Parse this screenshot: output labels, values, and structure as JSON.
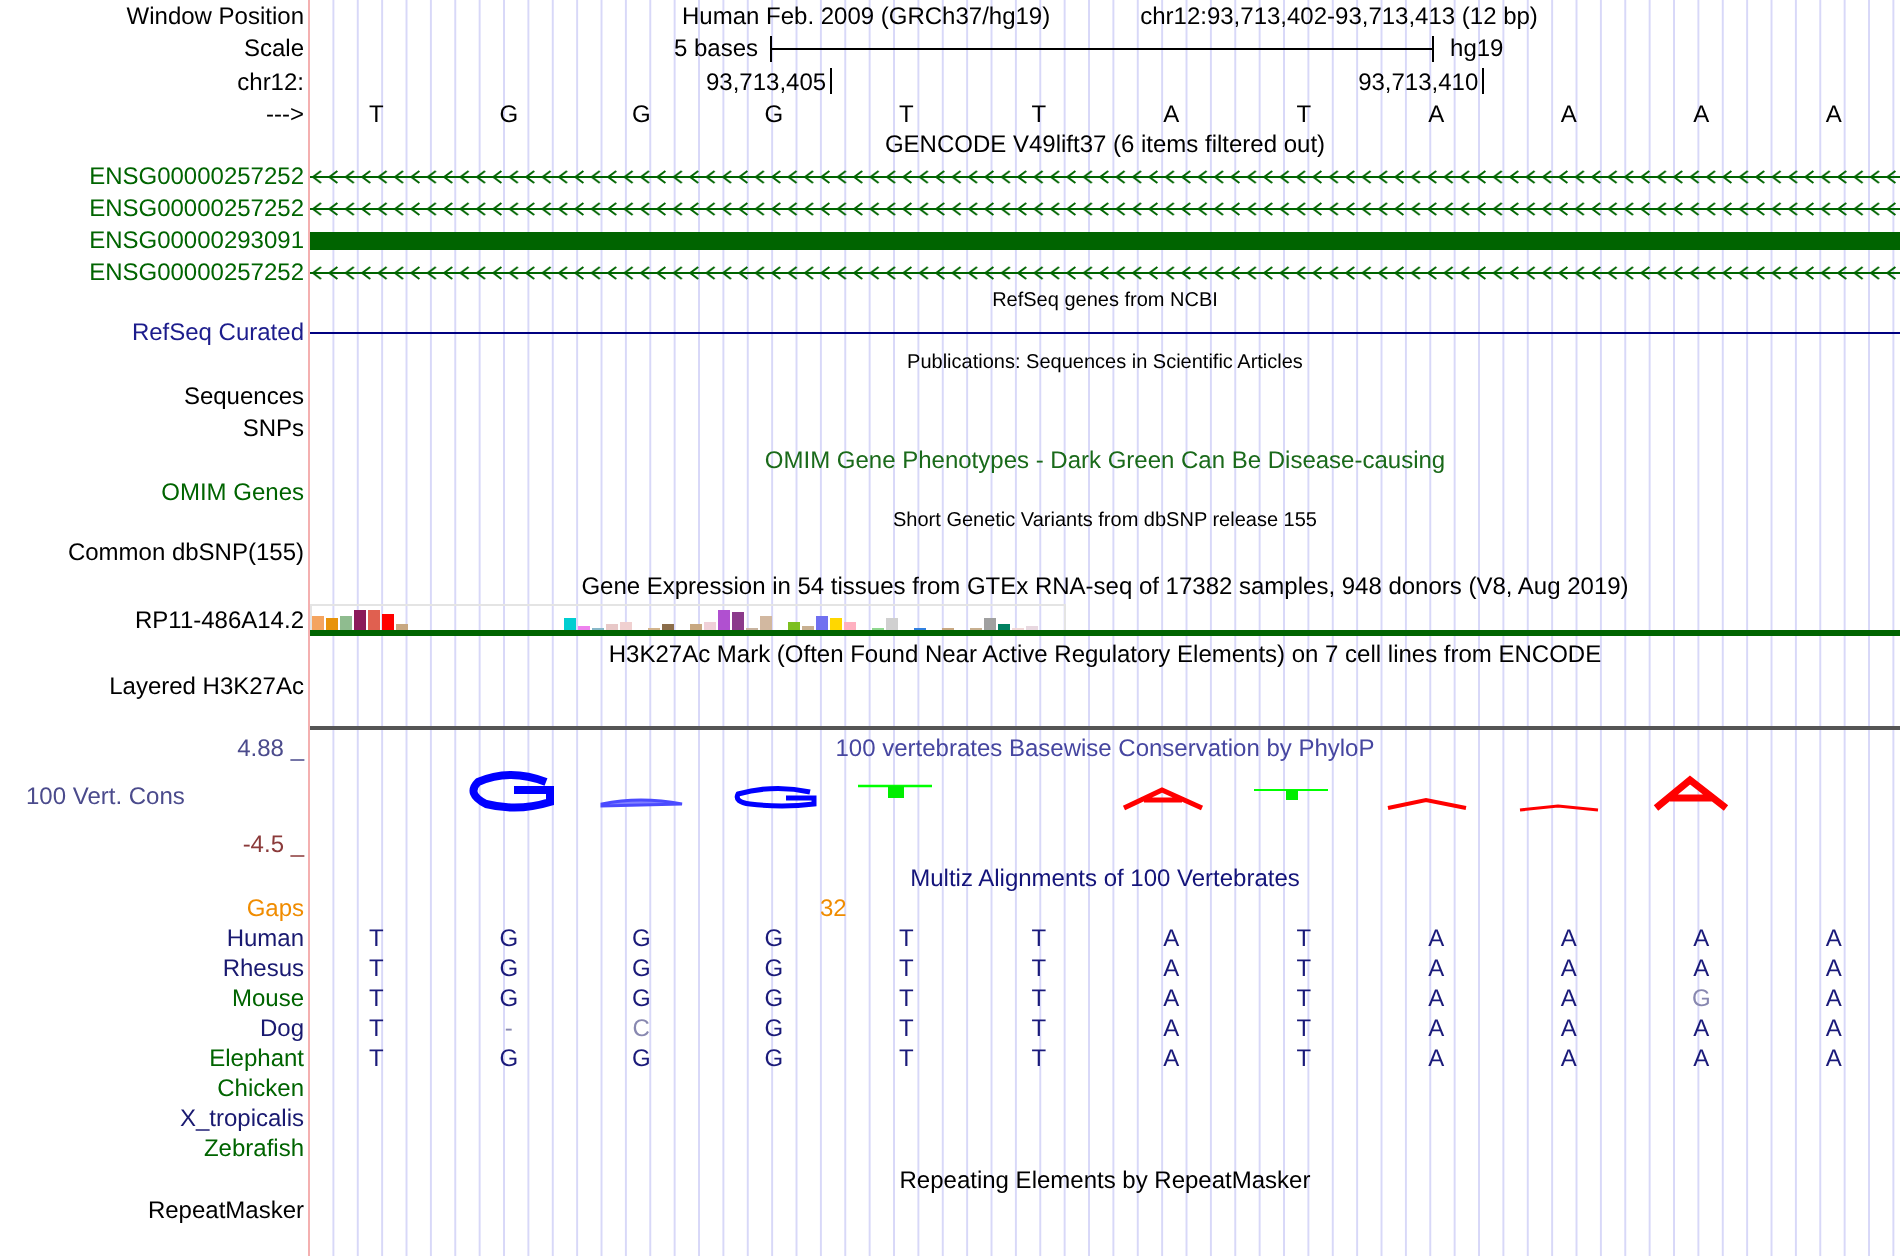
{
  "header": {
    "labels": [
      "Window Position",
      "Scale",
      "chr12:",
      "--->"
    ],
    "assembly_title": "Human Feb. 2009 (GRCh37/hg19)",
    "position": "chr12:93,713,402-93,713,413 (12 bp)",
    "scale_text": "5 bases",
    "assembly": "hg19",
    "ticks": [
      "93,713,405",
      "93,713,410"
    ]
  },
  "bases": [
    "T",
    "G",
    "G",
    "G",
    "T",
    "T",
    "A",
    "T",
    "A",
    "A",
    "A",
    "A"
  ],
  "tracks": [
    {
      "kind": "genes",
      "title": "GENCODE V49lift37 (6 items filtered out)",
      "items": [
        {
          "label": "ENSG00000257252",
          "kind": "arrows",
          "color": "#006400"
        },
        {
          "label": "ENSG00000257252",
          "kind": "arrows",
          "color": "#006400"
        },
        {
          "label": "ENSG00000293091",
          "kind": "block",
          "color": "#006400"
        },
        {
          "label": "ENSG00000257252",
          "kind": "arrows",
          "color": "#006400"
        }
      ]
    },
    {
      "kind": "refseq",
      "title": "RefSeq genes from NCBI",
      "label": "RefSeq Curated",
      "color": "#1c1c8c"
    },
    {
      "kind": "pubs",
      "title": "Publications: Sequences in Scientific Articles",
      "labels": [
        "Sequences",
        "SNPs"
      ],
      "color": "#000000"
    },
    {
      "kind": "omim",
      "title": "OMIM Gene Phenotypes - Dark Green Can Be Disease-causing",
      "label": "OMIM Genes",
      "color": "#006400"
    },
    {
      "kind": "snp",
      "title": "Short Genetic Variants from dbSNP release 155",
      "label": "Common dbSNP(155)",
      "color": "#000000"
    },
    {
      "kind": "gtex",
      "title": "Gene Expression in 54 tissues from GTEx RNA-seq of 17382 samples, 948 donors (V8, Aug 2019)",
      "label": "RP11-486A14.2",
      "color": "#000000"
    },
    {
      "kind": "chip",
      "title": "H3K27Ac Mark (Often Found Near Active Regulatory Elements) on 7 cell lines from ENCODE",
      "label": "Layered H3K27Ac",
      "color": "#000000"
    },
    {
      "kind": "phylop",
      "title": "100 vertebrates Basewise Conservation by PhyloP",
      "label": "100 Vert. Cons",
      "max": "4.88 _",
      "min": "-4.5 _",
      "color": "#4b4b8c"
    },
    {
      "kind": "multiz",
      "title": "Multiz Alignments of 100 Vertebrates",
      "gaps": {
        "label": "Gaps",
        "value": "32"
      },
      "species": [
        {
          "name": "Human",
          "color": "#191970",
          "bases": [
            {
              "b": "T",
              "match": true
            },
            {
              "b": "G",
              "match": true
            },
            {
              "b": "G",
              "match": true
            },
            {
              "b": "G",
              "match": true
            },
            {
              "b": "T",
              "match": true
            },
            {
              "b": "T",
              "match": true
            },
            {
              "b": "A",
              "match": true
            },
            {
              "b": "T",
              "match": true
            },
            {
              "b": "A",
              "match": true
            },
            {
              "b": "A",
              "match": true
            },
            {
              "b": "A",
              "match": true
            },
            {
              "b": "A",
              "match": true
            }
          ]
        },
        {
          "name": "Rhesus",
          "color": "#191970",
          "bases": [
            {
              "b": "T",
              "match": true
            },
            {
              "b": "G",
              "match": true
            },
            {
              "b": "G",
              "match": true
            },
            {
              "b": "G",
              "match": true
            },
            {
              "b": "T",
              "match": true
            },
            {
              "b": "T",
              "match": true
            },
            {
              "b": "A",
              "match": true
            },
            {
              "b": "T",
              "match": true
            },
            {
              "b": "A",
              "match": true
            },
            {
              "b": "A",
              "match": true
            },
            {
              "b": "A",
              "match": true
            },
            {
              "b": "A",
              "match": true
            }
          ]
        },
        {
          "name": "Mouse",
          "color": "#006400",
          "bases": [
            {
              "b": "T",
              "match": true
            },
            {
              "b": "G",
              "match": true
            },
            {
              "b": "G",
              "match": true
            },
            {
              "b": "G",
              "match": true
            },
            {
              "b": "T",
              "match": true
            },
            {
              "b": "T",
              "match": true
            },
            {
              "b": "A",
              "match": true
            },
            {
              "b": "T",
              "match": true
            },
            {
              "b": "A",
              "match": true
            },
            {
              "b": "A",
              "match": true
            },
            {
              "b": "G",
              "match": false
            },
            {
              "b": "A",
              "match": true
            }
          ]
        },
        {
          "name": "Dog",
          "color": "#191970",
          "bases": [
            {
              "b": "T",
              "match": true
            },
            {
              "b": "-",
              "match": false
            },
            {
              "b": "C",
              "match": false
            },
            {
              "b": "G",
              "match": true
            },
            {
              "b": "T",
              "match": true
            },
            {
              "b": "T",
              "match": true
            },
            {
              "b": "A",
              "match": true
            },
            {
              "b": "T",
              "match": true
            },
            {
              "b": "A",
              "match": true
            },
            {
              "b": "A",
              "match": true
            },
            {
              "b": "A",
              "match": true
            },
            {
              "b": "A",
              "match": true
            }
          ]
        },
        {
          "name": "Elephant",
          "color": "#006400",
          "bases": [
            {
              "b": "T",
              "match": true
            },
            {
              "b": "G",
              "match": true
            },
            {
              "b": "G",
              "match": true
            },
            {
              "b": "G",
              "match": true
            },
            {
              "b": "T",
              "match": true
            },
            {
              "b": "T",
              "match": true
            },
            {
              "b": "A",
              "match": true
            },
            {
              "b": "T",
              "match": true
            },
            {
              "b": "A",
              "match": true
            },
            {
              "b": "A",
              "match": true
            },
            {
              "b": "A",
              "match": true
            },
            {
              "b": "A",
              "match": true
            }
          ]
        },
        {
          "name": "Chicken",
          "color": "#006400"
        },
        {
          "name": "X_tropicalis",
          "color": "#191970"
        },
        {
          "name": "Zebrafish",
          "color": "#006400"
        }
      ]
    },
    {
      "kind": "rmsk",
      "title": "Repeating Elements by RepeatMasker",
      "label": "RepeatMasker",
      "color": "#000000"
    }
  ]
}
